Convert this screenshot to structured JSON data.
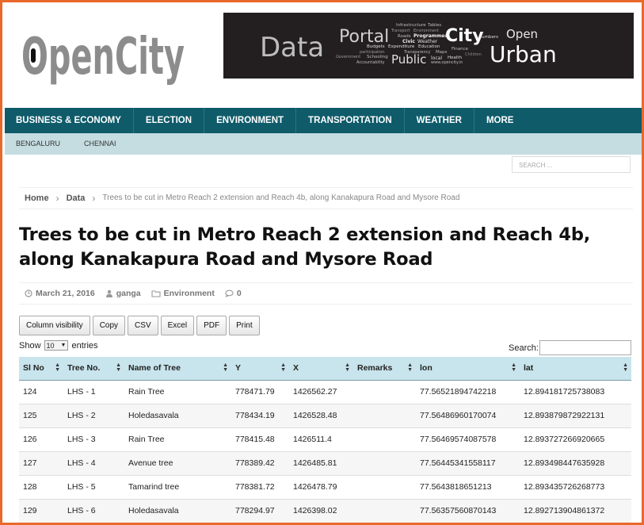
{
  "logo": {
    "text": "OpenCity"
  },
  "banner": {
    "big_words": [
      "Data",
      "Portal",
      "City",
      "Open",
      "Urban",
      "Public"
    ],
    "small_words": [
      "Infrastructure",
      "Tables",
      "Transport",
      "Environment",
      "Roads",
      "Programmes",
      "Civic",
      "Weather",
      "Budgets",
      "Expenditure",
      "Education",
      "Finance",
      "participation",
      "Transparency",
      "Maps",
      "Children",
      "Government",
      "Schooling",
      "local",
      "Health",
      "Accountability",
      "www.opencity.in",
      "Numbers"
    ]
  },
  "nav": {
    "main": [
      "BUSINESS & ECONOMY",
      "ELECTION",
      "ENVIRONMENT",
      "TRANSPORTATION",
      "WEATHER",
      "MORE"
    ],
    "sub": [
      "BENGALURU",
      "CHENNAI"
    ],
    "search_placeholder": "SEARCH ..."
  },
  "breadcrumb": {
    "home": "Home",
    "data": "Data",
    "current": "Trees to be cut in Metro Reach 2 extension and Reach 4b, along Kanakapura Road and Mysore Road"
  },
  "article": {
    "title": "Trees to be cut in Metro Reach 2 extension and Reach 4b, along Kanakapura Road and Mysore Road",
    "date": "March 21, 2016",
    "author": "ganga",
    "category": "Environment",
    "comments": "0"
  },
  "buttons": [
    "Column visibility",
    "Copy",
    "CSV",
    "Excel",
    "PDF",
    "Print"
  ],
  "table_controls": {
    "show_label": "Show",
    "show_value": "10",
    "entries_label": "entries",
    "search_label": "Search:"
  },
  "table": {
    "headers": [
      "Sl No",
      "Tree No.",
      "Name of Tree",
      "Y",
      "X",
      "Remarks",
      "lon",
      "lat"
    ],
    "rows": [
      [
        "124",
        "LHS - 1",
        "Rain Tree",
        "778471.79",
        "1426562.27",
        "",
        "77.56521894742218",
        "12.894181725738083"
      ],
      [
        "125",
        "LHS - 2",
        "Holedasavala",
        "778434.19",
        "1426528.48",
        "",
        "77.56486960170074",
        "12.893879872922131"
      ],
      [
        "126",
        "LHS - 3",
        "Rain Tree",
        "778415.48",
        "1426511.4",
        "",
        "77.56469574087578",
        "12.893727266920665"
      ],
      [
        "127",
        "LHS - 4",
        "Avenue tree",
        "778389.42",
        "1426485.81",
        "",
        "77.56445341558117",
        "12.893498447635928"
      ],
      [
        "128",
        "LHS - 5",
        "Tamarind tree",
        "778381.72",
        "1426478.79",
        "",
        "77.5643818651213",
        "12.893435726268773"
      ],
      [
        "129",
        "LHS - 6",
        "Holedasavala",
        "778294.97",
        "1426398.02",
        "",
        "77.56357560870143",
        "12.892713904861372"
      ]
    ]
  },
  "colors": {
    "frame": "#e8692a",
    "nav": "#0f5b6a",
    "subnav": "#c5dde1",
    "table_header": "#c8e4ec"
  }
}
